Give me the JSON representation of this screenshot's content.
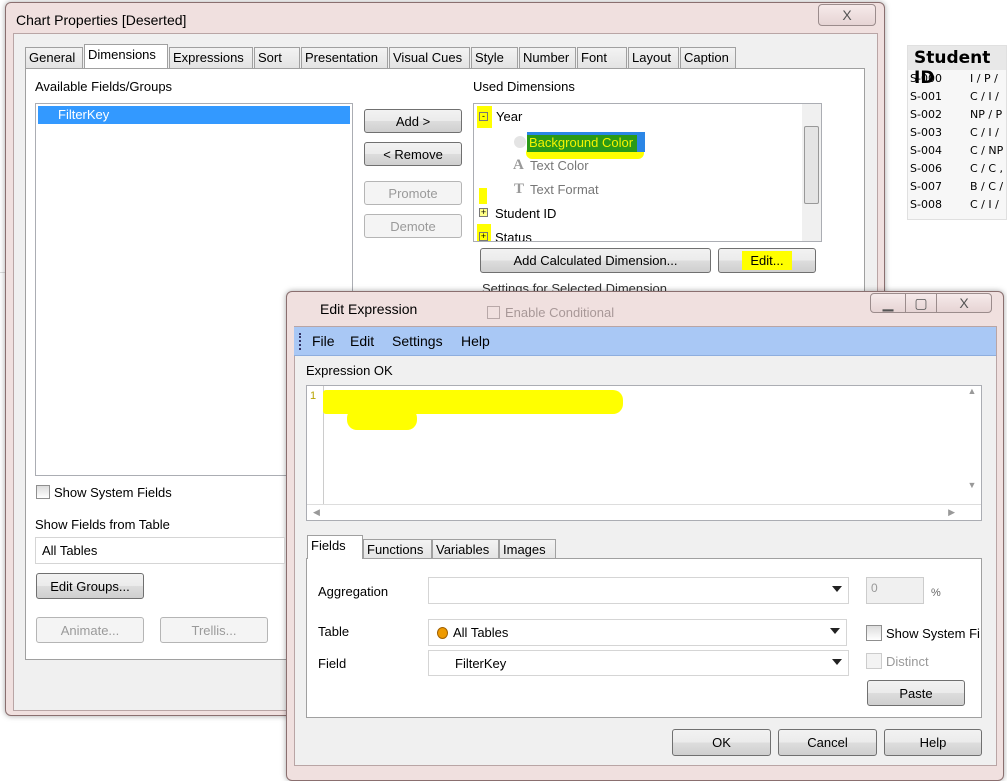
{
  "background_table": {
    "header": "Student ID",
    "rows": [
      {
        "id": "S-000",
        "value": "I / P /"
      },
      {
        "id": "S-001",
        "value": "C / I /"
      },
      {
        "id": "S-002",
        "value": "NP / P"
      },
      {
        "id": "S-003",
        "value": "C / I /"
      },
      {
        "id": "S-004",
        "value": "C / NP"
      },
      {
        "id": "S-006",
        "value": "C / C ,"
      },
      {
        "id": "S-007",
        "value": "B / C /"
      },
      {
        "id": "S-008",
        "value": "C / I /"
      }
    ]
  },
  "chart_properties": {
    "title": "Chart Properties [Deserted]",
    "close_icon": "X",
    "tabs": [
      "General",
      "Dimensions",
      "Expressions",
      "Sort",
      "Presentation",
      "Visual Cues",
      "Style",
      "Number",
      "Font",
      "Layout",
      "Caption"
    ],
    "selected_tab": "Dimensions",
    "available_label": "Available Fields/Groups",
    "available_items": [
      "FilterKey"
    ],
    "add": "Add >",
    "remove": "< Remove",
    "promote": "Promote",
    "demote": "Demote",
    "used_label": "Used Dimensions",
    "used_tree": {
      "year": "Year",
      "background_color": "Background Color",
      "text_color": "Text Color",
      "text_format": "Text Format",
      "student_id": "Student ID",
      "status": "Status"
    },
    "add_calc": "Add Calculated Dimension...",
    "edit": "Edit...",
    "settings_label": "Settings for Selected Dimension",
    "enable_conditional": "Enable Conditional",
    "show_system_fields": "Show System Fields",
    "show_fields_from_table": "Show Fields from Table",
    "table_value": "All Tables",
    "edit_groups": "Edit Groups...",
    "animate": "Animate...",
    "trellis": "Trellis...",
    "highlight_color": "#ffff00",
    "selection_color": "#3399ff"
  },
  "edit_expression": {
    "title": "Edit Expression",
    "menu": [
      "File",
      "Edit",
      "Settings",
      "Help"
    ],
    "status": "Expression OK",
    "line_number": "1",
    "tabs": [
      "Fields",
      "Functions",
      "Variables",
      "Images"
    ],
    "selected_tab": "Fields",
    "aggregation_label": "Aggregation",
    "aggregation_value": "",
    "percent_value": "0",
    "percent_sign": "%",
    "table_label": "Table",
    "table_value": "All Tables",
    "field_label": "Field",
    "field_value": "FilterKey",
    "show_system_fields": "Show System Fi",
    "distinct": "Distinct",
    "paste": "Paste",
    "ok": "OK",
    "cancel": "Cancel",
    "help": "Help",
    "menu_color": "#a9c8f5"
  }
}
